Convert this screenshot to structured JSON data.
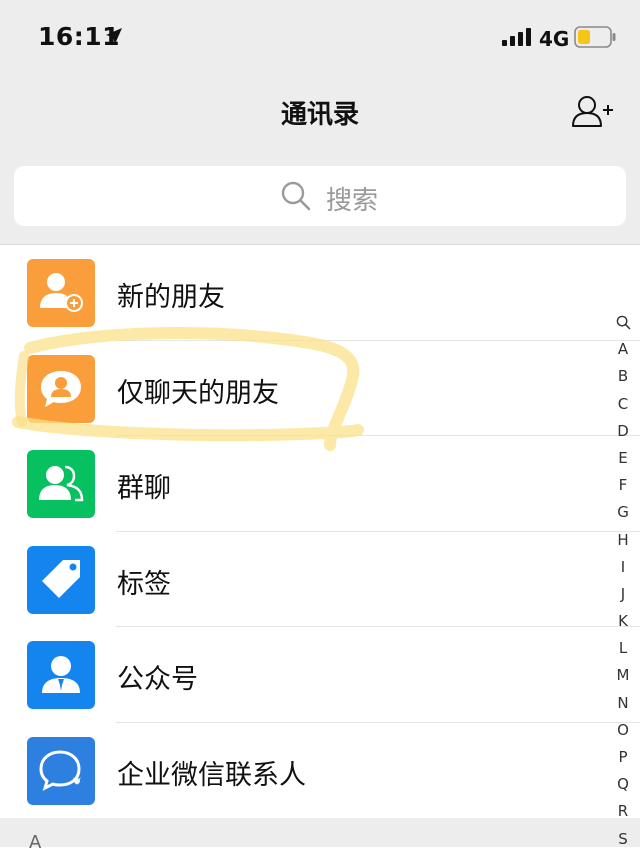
{
  "status_bar": {
    "time": "16:11",
    "network": "4G",
    "location_icon": "location-arrow-icon",
    "signal_icon": "cellular-signal-icon",
    "battery_icon": "battery-low-icon",
    "battery_level": 0.3,
    "battery_color": "#f5c518"
  },
  "nav": {
    "title": "通讯录",
    "add_friend_icon": "add-contact-icon"
  },
  "search": {
    "placeholder": "搜索",
    "icon": "search-icon"
  },
  "menu": {
    "items": [
      {
        "label": "新的朋友",
        "icon": "new-friend-icon",
        "color": "#fa9d3b"
      },
      {
        "label": "仅聊天的朋友",
        "icon": "chat-only-friend-icon",
        "color": "#fa9d3b"
      },
      {
        "label": "群聊",
        "icon": "group-chat-icon",
        "color": "#07c160"
      },
      {
        "label": "标签",
        "icon": "tag-icon",
        "color": "#1485ee"
      },
      {
        "label": "公众号",
        "icon": "official-account-icon",
        "color": "#1485ee"
      },
      {
        "label": "企业微信联系人",
        "icon": "enterprise-contact-icon",
        "color": "#2d7fe0"
      }
    ]
  },
  "section": {
    "header": "A"
  },
  "index_bar": {
    "search_icon": "index-search-icon",
    "letters": [
      "A",
      "B",
      "C",
      "D",
      "E",
      "F",
      "G",
      "H",
      "I",
      "J",
      "K",
      "L",
      "M",
      "N",
      "O",
      "P",
      "Q",
      "R",
      "S"
    ]
  }
}
